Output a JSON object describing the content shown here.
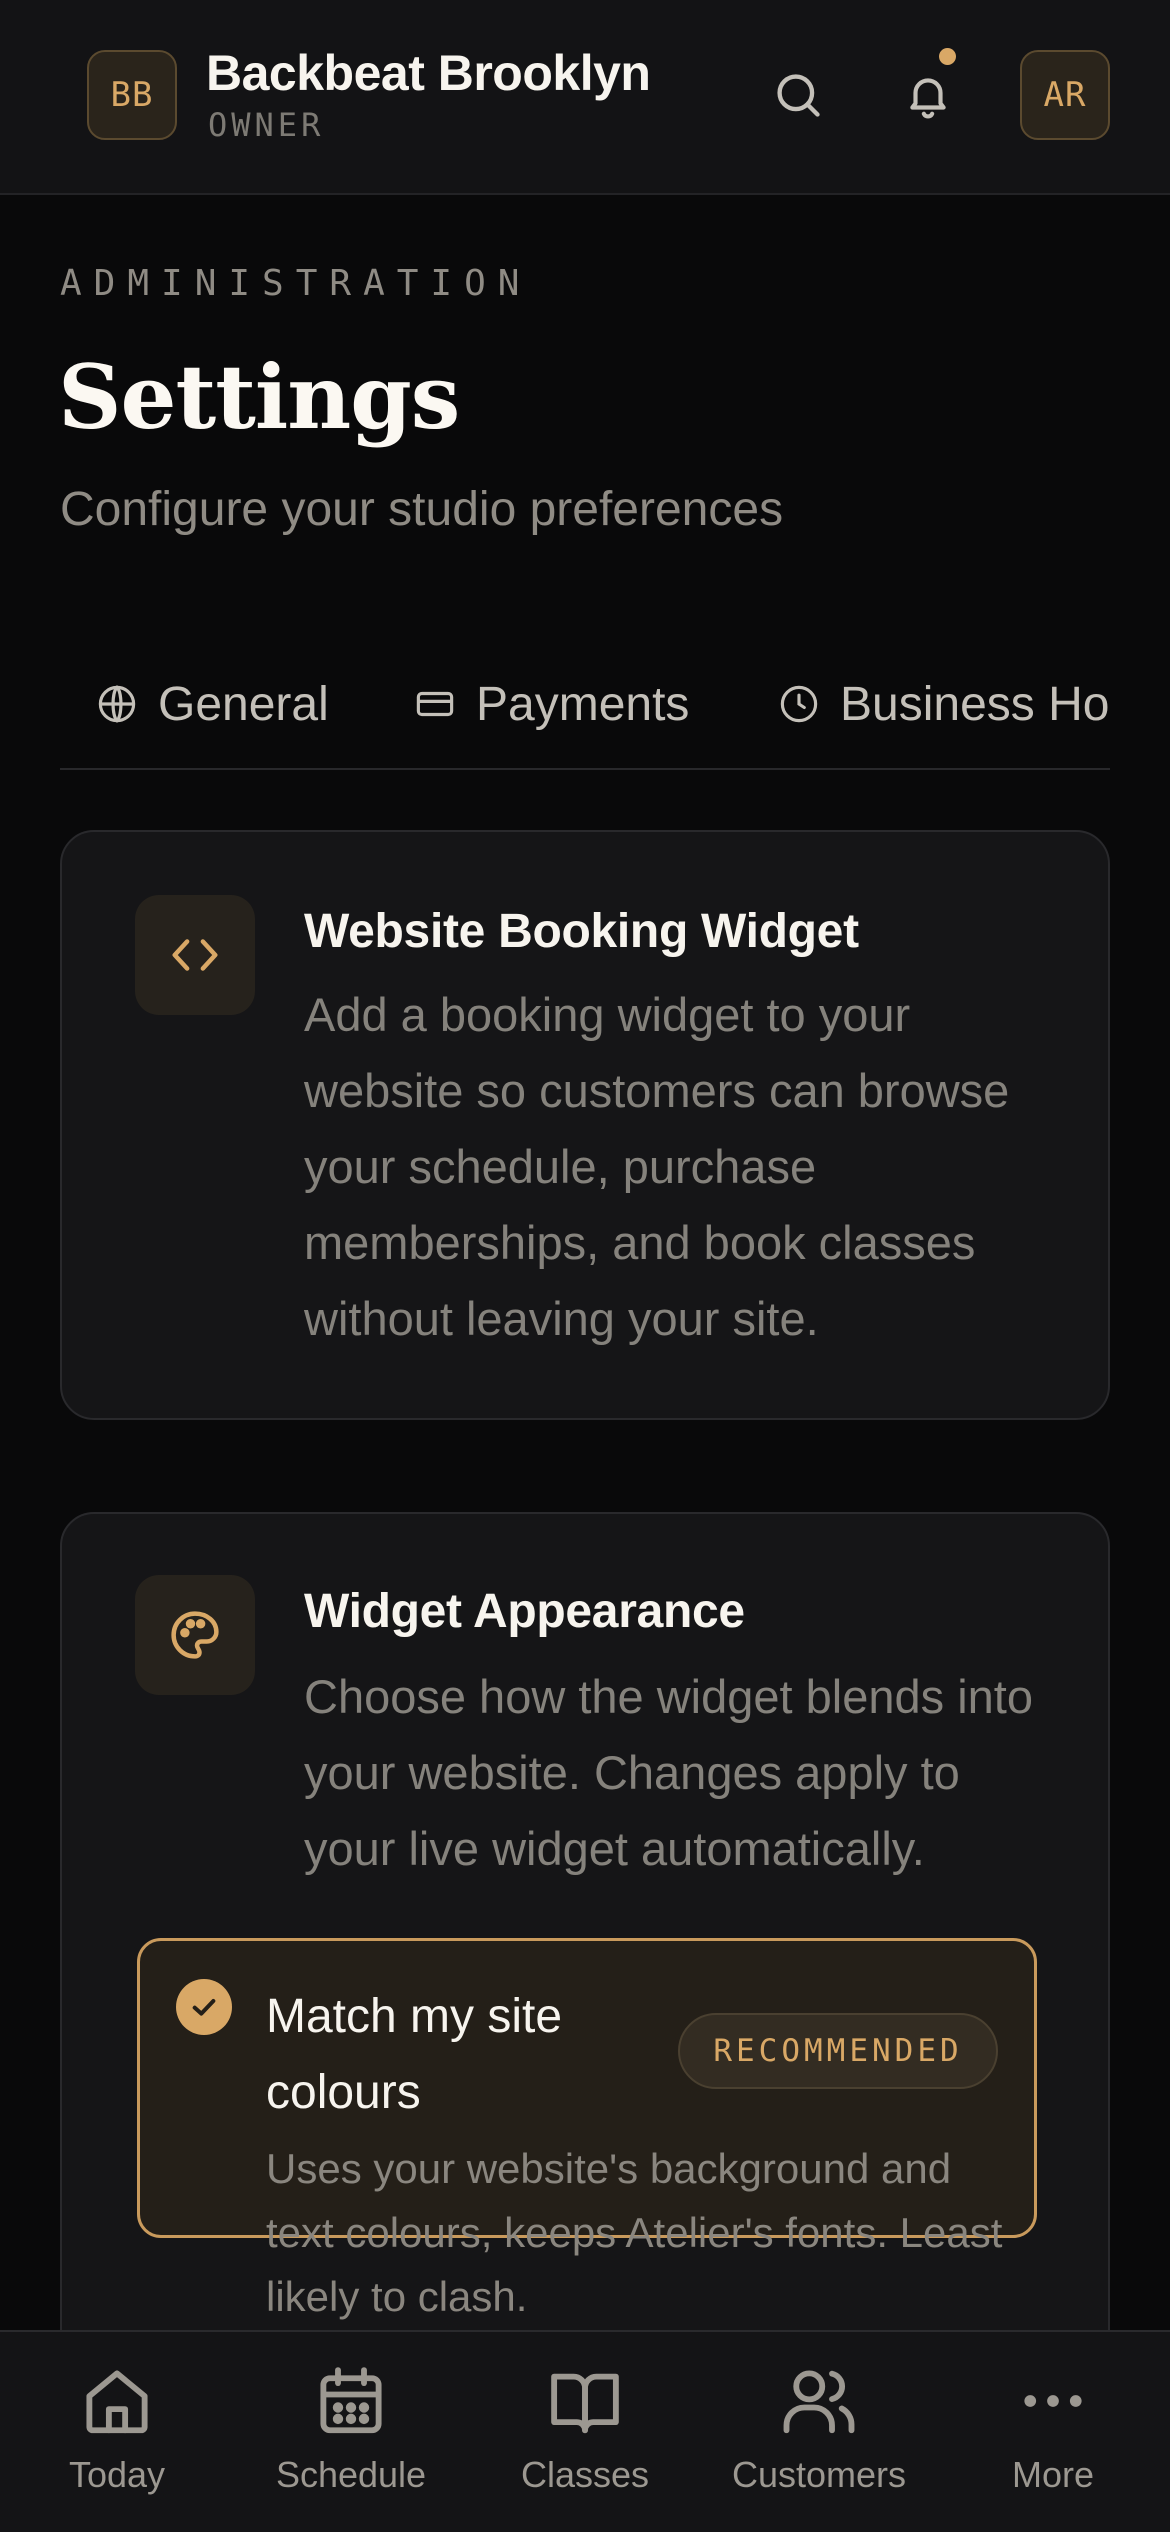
{
  "header": {
    "studio_initials": "BB",
    "studio_name": "Backbeat Brooklyn",
    "role": "OWNER",
    "user_initials": "AR"
  },
  "page": {
    "eyebrow": "ADMINISTRATION",
    "title": "Settings",
    "subtitle": "Configure your studio preferences"
  },
  "tabs": [
    {
      "label": "General",
      "icon": "globe-icon"
    },
    {
      "label": "Payments",
      "icon": "credit-card-icon"
    },
    {
      "label": "Business Ho",
      "icon": "clock-icon"
    }
  ],
  "cards": {
    "widget": {
      "title": "Website Booking Widget",
      "description": "Add a booking widget to your website so customers can browse your schedule, purchase memberships, and book classes without leaving your site.",
      "icon": "code-icon"
    },
    "appearance": {
      "title": "Widget Appearance",
      "description": "Choose how the widget blends into your website. Changes apply to your live widget automatically.",
      "icon": "palette-icon",
      "option": {
        "title": "Match my site colours",
        "badge": "RECOMMENDED",
        "description": "Uses your website's background and text colours, keeps Atelier's fonts. Least likely to clash.",
        "selected": true
      }
    }
  },
  "nav": [
    {
      "label": "Today",
      "icon": "home-icon"
    },
    {
      "label": "Schedule",
      "icon": "calendar-icon"
    },
    {
      "label": "Classes",
      "icon": "book-icon"
    },
    {
      "label": "Customers",
      "icon": "users-icon"
    },
    {
      "label": "More",
      "icon": "more-icon"
    }
  ],
  "colors": {
    "accent": "#d9a866",
    "background": "#09090a",
    "card": "#151517"
  }
}
